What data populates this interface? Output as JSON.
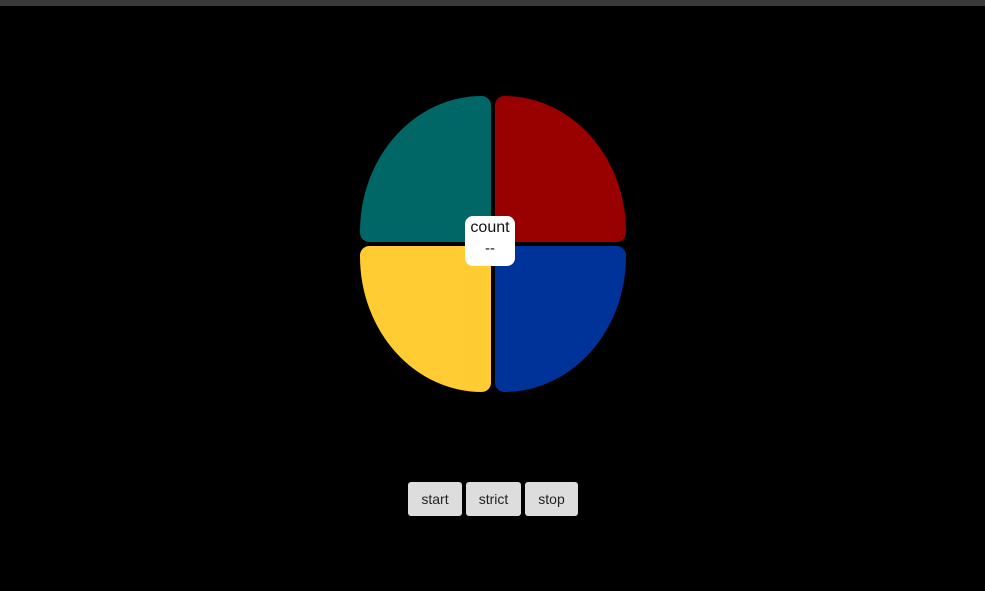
{
  "colors": {
    "background": "#000000",
    "topbar": "#3a3a3a",
    "pad_green": "#006666",
    "pad_red": "#990000",
    "pad_yellow": "#ffcc33",
    "pad_blue": "#003399",
    "counter_bg": "#ffffff",
    "button_bg": "#dddddd"
  },
  "counter": {
    "label": "count",
    "value": "--"
  },
  "controls": {
    "start_label": "start",
    "strict_label": "strict",
    "stop_label": "stop"
  }
}
